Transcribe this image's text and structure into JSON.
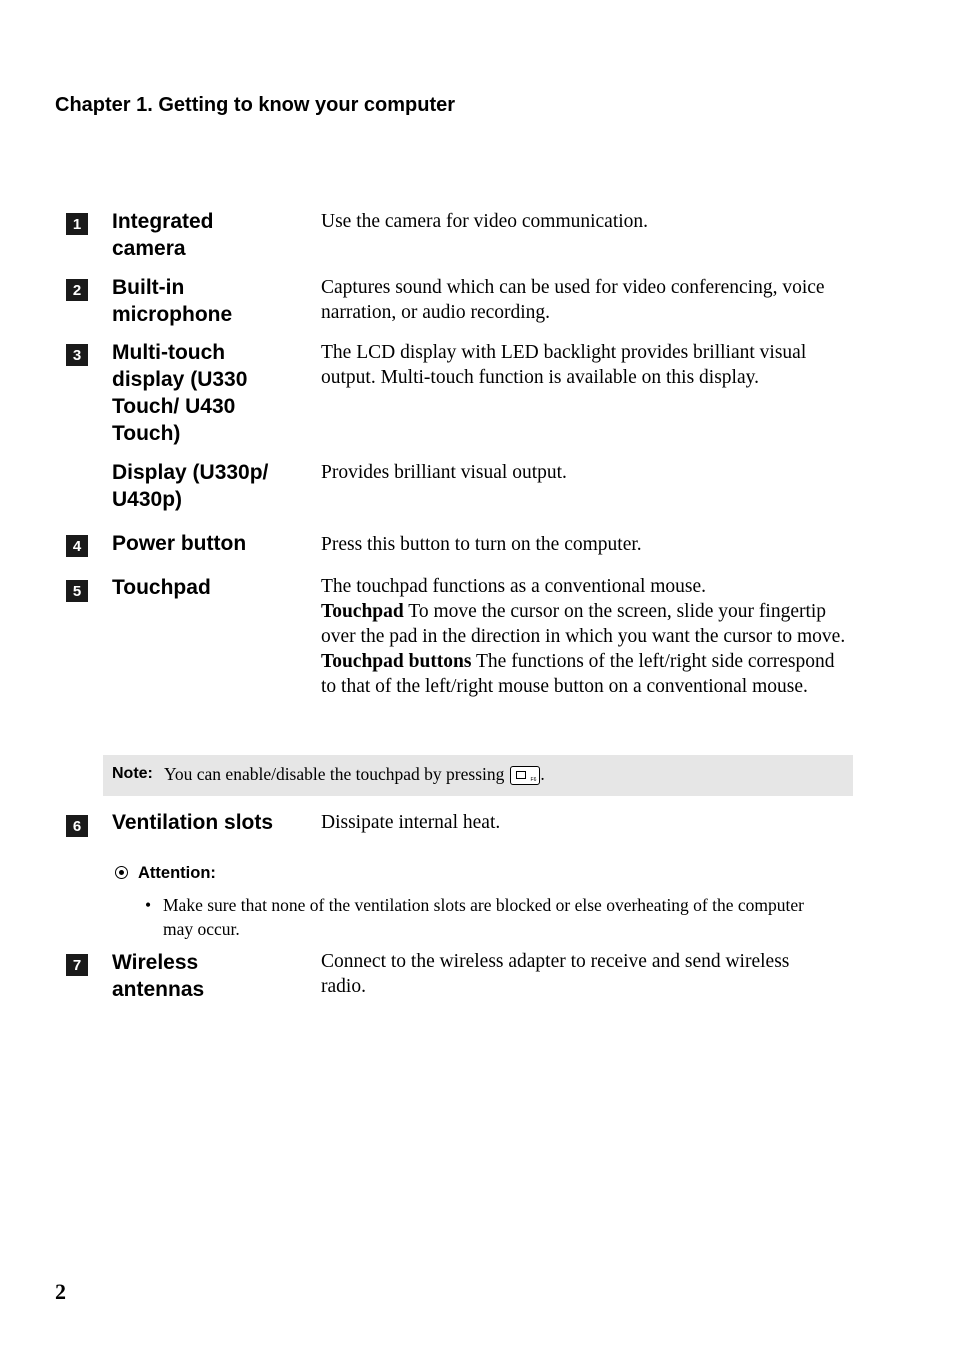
{
  "header": {
    "chapter_title": "Chapter 1. Getting to know your computer"
  },
  "items": [
    {
      "number": "1",
      "term": "Integrated camera",
      "description": "Use the camera for video communication."
    },
    {
      "number": "2",
      "term": "Built-in microphone",
      "description": "Captures sound which can be used for video conferencing, voice narration, or audio recording."
    },
    {
      "number": "3",
      "term": "Multi-touch display (U330 Touch/ U430 Touch)",
      "description": "The LCD display with LED backlight provides brilliant visual output. Multi-touch function is available on this display."
    },
    {
      "number": "",
      "term": "Display (U330p/ U430p)",
      "description": "Provides brilliant visual output."
    },
    {
      "number": "4",
      "term": "Power button",
      "description": "Press this button to turn on the computer."
    },
    {
      "number": "5",
      "term": "Touchpad",
      "description": "The touchpad functions as a conventional mouse.",
      "sub": [
        {
          "bold": "Touchpad",
          "text": " To move the cursor on the screen, slide your fingertip over the pad in the direction in which you want the cursor to move."
        },
        {
          "bold": "Touchpad buttons",
          "text": " The functions of the left/right side correspond to that of the left/right mouse button on a conventional mouse."
        }
      ]
    },
    {
      "number": "6",
      "term": "Ventilation slots",
      "description": "Dissipate internal heat."
    },
    {
      "number": "7",
      "term": "Wireless antennas",
      "description": "Connect to the wireless adapter to receive and send wireless radio."
    }
  ],
  "note": {
    "label": "Note:",
    "text": "You can enable/disable the touchpad by pressing",
    "key_icon": "touchpad-toggle-key-icon",
    "key_label": "F6",
    "suffix": "."
  },
  "attention": {
    "label": "Attention:",
    "bullets": [
      "Make sure that none of the ventilation slots are blocked or else overheating of the computer may occur."
    ]
  },
  "footer": {
    "page_number": "2"
  }
}
